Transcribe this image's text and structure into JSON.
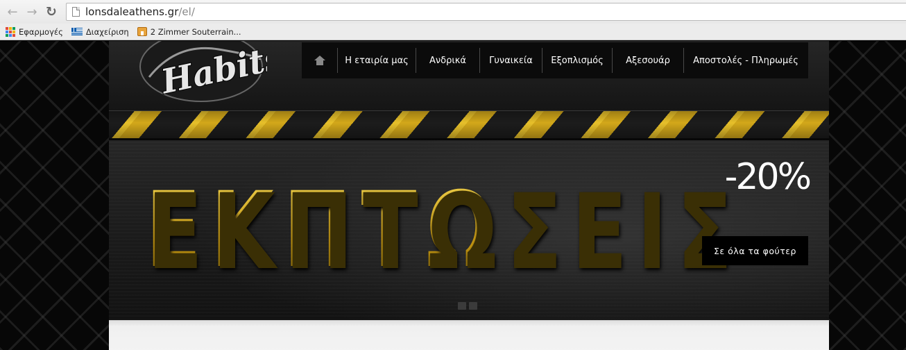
{
  "browser": {
    "url_host": "lonsdaleathens.gr",
    "url_path": "/el/",
    "bookmarks": [
      {
        "label": "Εφαρμογές"
      },
      {
        "label": "Διαχείριση"
      },
      {
        "label": "2 Zimmer Souterrain..."
      }
    ]
  },
  "site": {
    "logo_text": "Habits",
    "nav": [
      {
        "label": "Η εταιρία μας"
      },
      {
        "label": "Ανδρικά"
      },
      {
        "label": "Γυναικεία"
      },
      {
        "label": "Εξοπλισμός"
      },
      {
        "label": "Αξεσουάρ"
      },
      {
        "label": "Αποστολές - Πληρωμές"
      }
    ]
  },
  "slider": {
    "headline": "ΕΚΠΤΩΣΕΙΣ",
    "discount": "-20%",
    "cta_label": "Σε όλα τα φούτερ",
    "slide_count": 2
  },
  "colors": {
    "hazard_yellow": "#d3a81a",
    "nav_bg": "#0b0b0b",
    "title_gold": "#d7b21d"
  }
}
